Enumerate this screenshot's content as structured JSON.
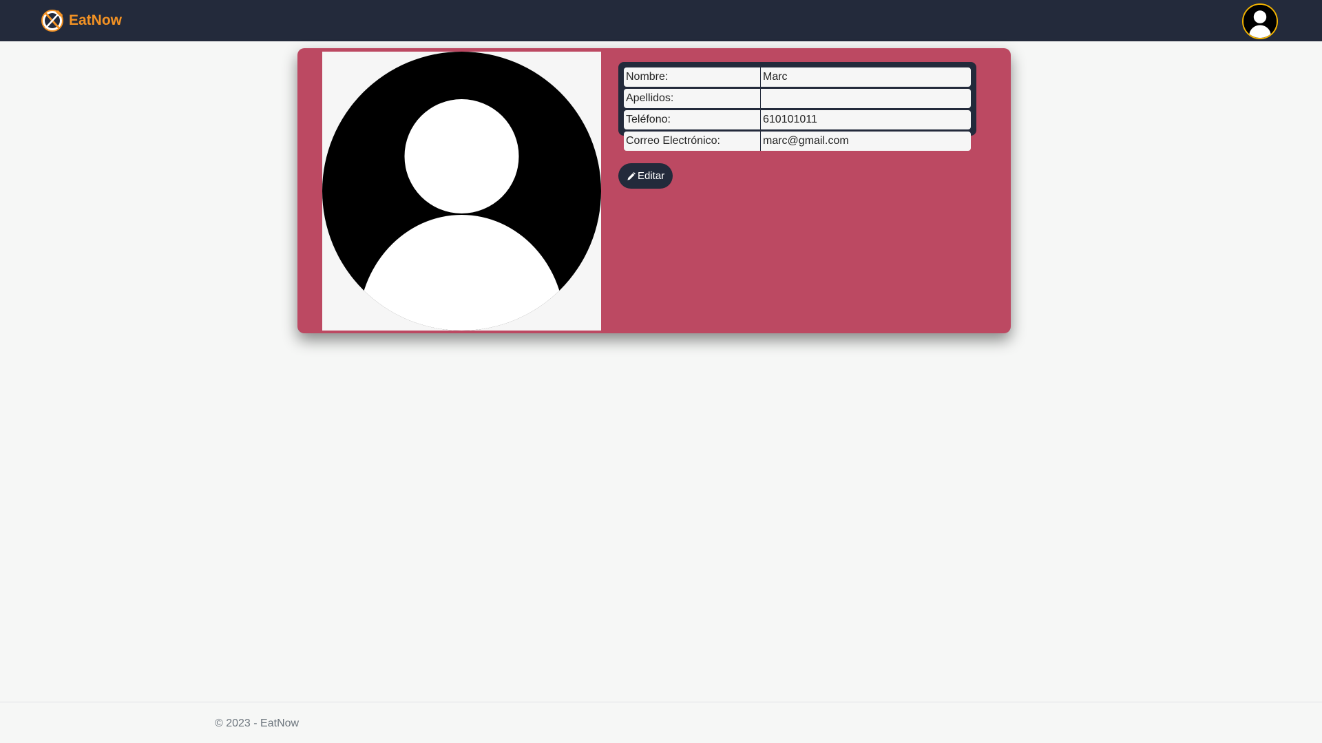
{
  "navbar": {
    "brand_name": "EatNow",
    "brand_icon": "fork-knife-logo-icon",
    "profile_icon": "user-avatar-icon",
    "accent_color": "#f39224"
  },
  "profile": {
    "photo_icon": "default-user-silhouette-icon",
    "fields": [
      {
        "label": "Nombre:",
        "value": "Marc"
      },
      {
        "label": "Apellidos:",
        "value": ""
      },
      {
        "label": "Teléfono:",
        "value": "610101011"
      },
      {
        "label": "Correo Electrónico:",
        "value": "marc@gmail.com"
      }
    ],
    "edit_label": "Editar",
    "edit_icon": "pencil-icon",
    "card_color": "#bc4962",
    "dark_color": "#232a3b"
  },
  "footer": {
    "text": "© 2023 - EatNow"
  }
}
